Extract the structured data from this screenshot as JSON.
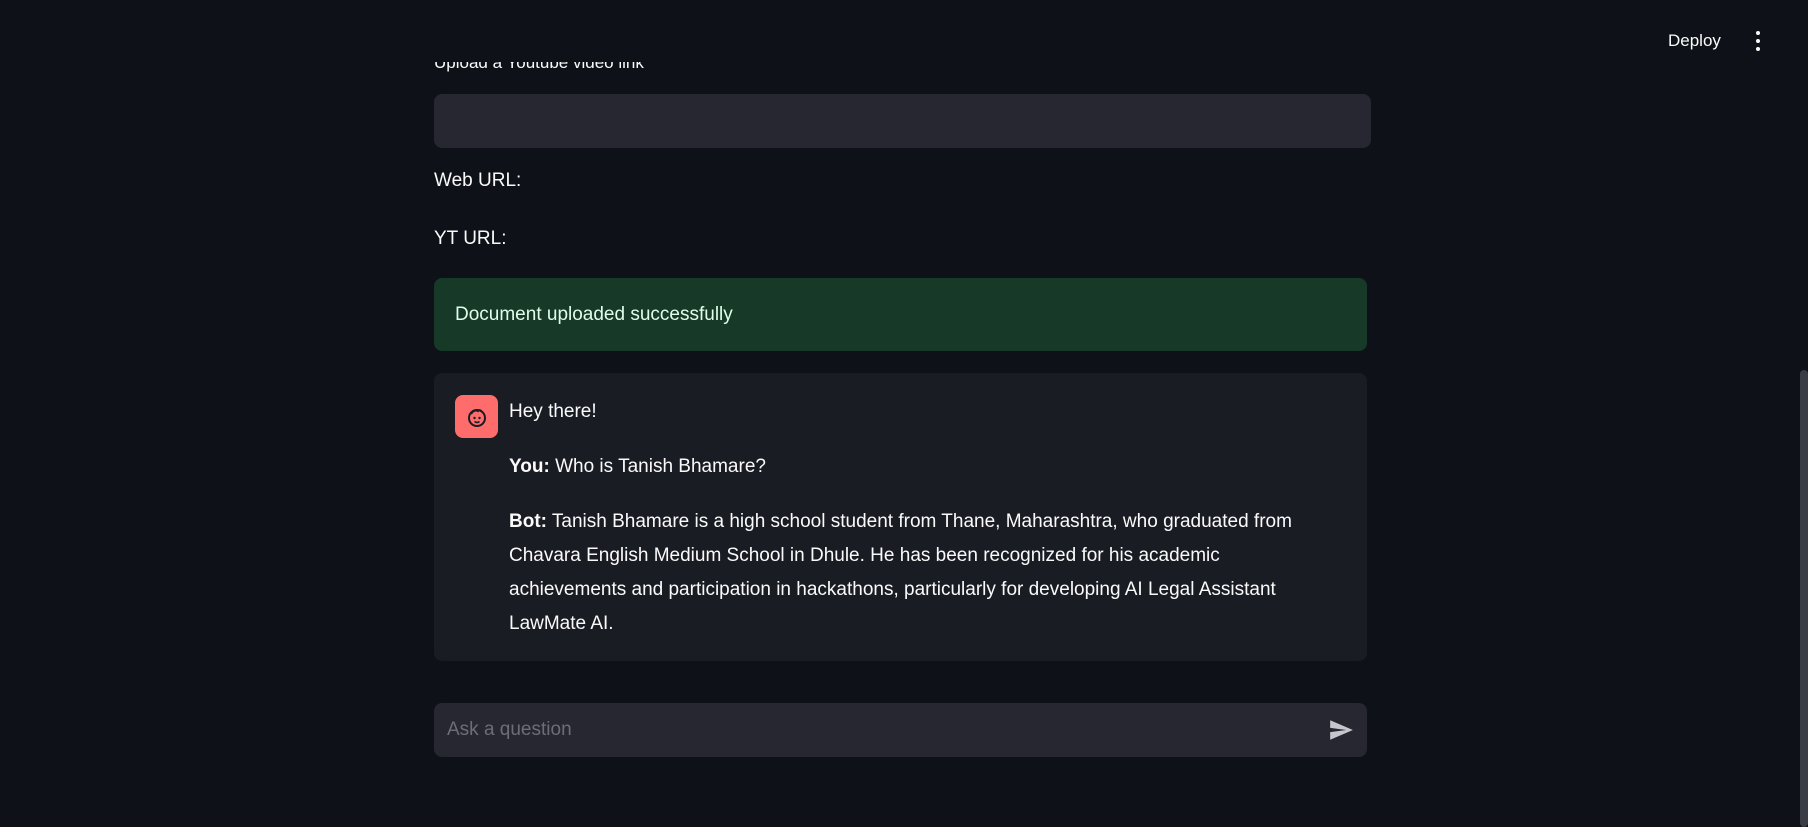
{
  "header": {
    "deploy_label": "Deploy",
    "menu_icon": "vertical-ellipsis-icon"
  },
  "form": {
    "youtube_label": "Upload a Youtube video link",
    "youtube_value": "",
    "web_url_label": "Web URL:",
    "yt_url_label": "YT URL:"
  },
  "status": {
    "success_message": "Document uploaded successfully",
    "success_color": "#173928"
  },
  "chat": {
    "avatar_icon": "smiling-face-icon",
    "avatar_color": "#ff6c6c",
    "greeting": "Hey there!",
    "messages": [
      {
        "speaker": "You:",
        "text": " Who is Tanish Bhamare?"
      },
      {
        "speaker": "Bot:",
        "text": " Tanish Bhamare is a high school student from Thane, Maharashtra, who graduated from Chavara English Medium School in Dhule. He has been recognized for his academic achievements and participation in hackathons, particularly for developing AI Legal Assistant LawMate AI."
      }
    ]
  },
  "chat_input": {
    "placeholder": "Ask a question",
    "value": "",
    "send_icon": "send-icon"
  }
}
